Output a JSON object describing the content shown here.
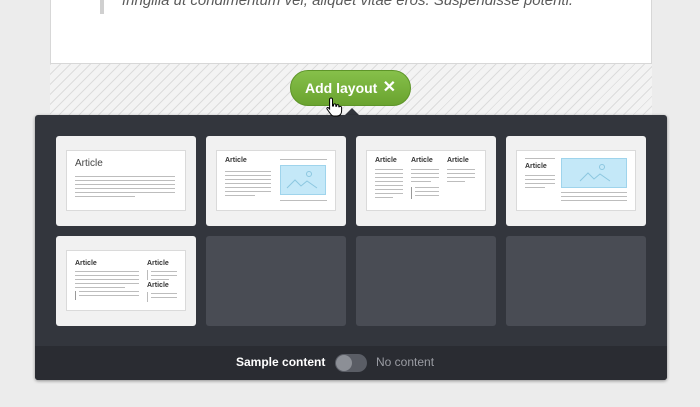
{
  "editor": {
    "quote_text": "fringilla ut condimentum vel, aliquet vitae eros. Suspendisse potenti."
  },
  "add_layout": {
    "label": "Add layout",
    "close_glyph": "✕"
  },
  "layouts": [
    {
      "name": "single-article",
      "titles": [
        "Article"
      ]
    },
    {
      "name": "article-with-image",
      "titles": [
        "Article"
      ]
    },
    {
      "name": "three-articles",
      "titles": [
        "Article",
        "Article",
        "Article"
      ]
    },
    {
      "name": "article-with-wide-image",
      "titles": [
        "Article"
      ]
    },
    {
      "name": "article-with-sidebar",
      "titles": [
        "Article",
        "Article",
        "Article"
      ]
    }
  ],
  "footer": {
    "sample_label": "Sample content",
    "no_content_label": "No content",
    "toggle_state": "off"
  },
  "icons": {
    "close": "close-icon",
    "cursor": "hand-pointer-icon",
    "image": "image-placeholder-icon"
  },
  "colors": {
    "accent_green": "#76b03c",
    "panel": "#33363d",
    "image_placeholder": "#c4e8f8"
  }
}
